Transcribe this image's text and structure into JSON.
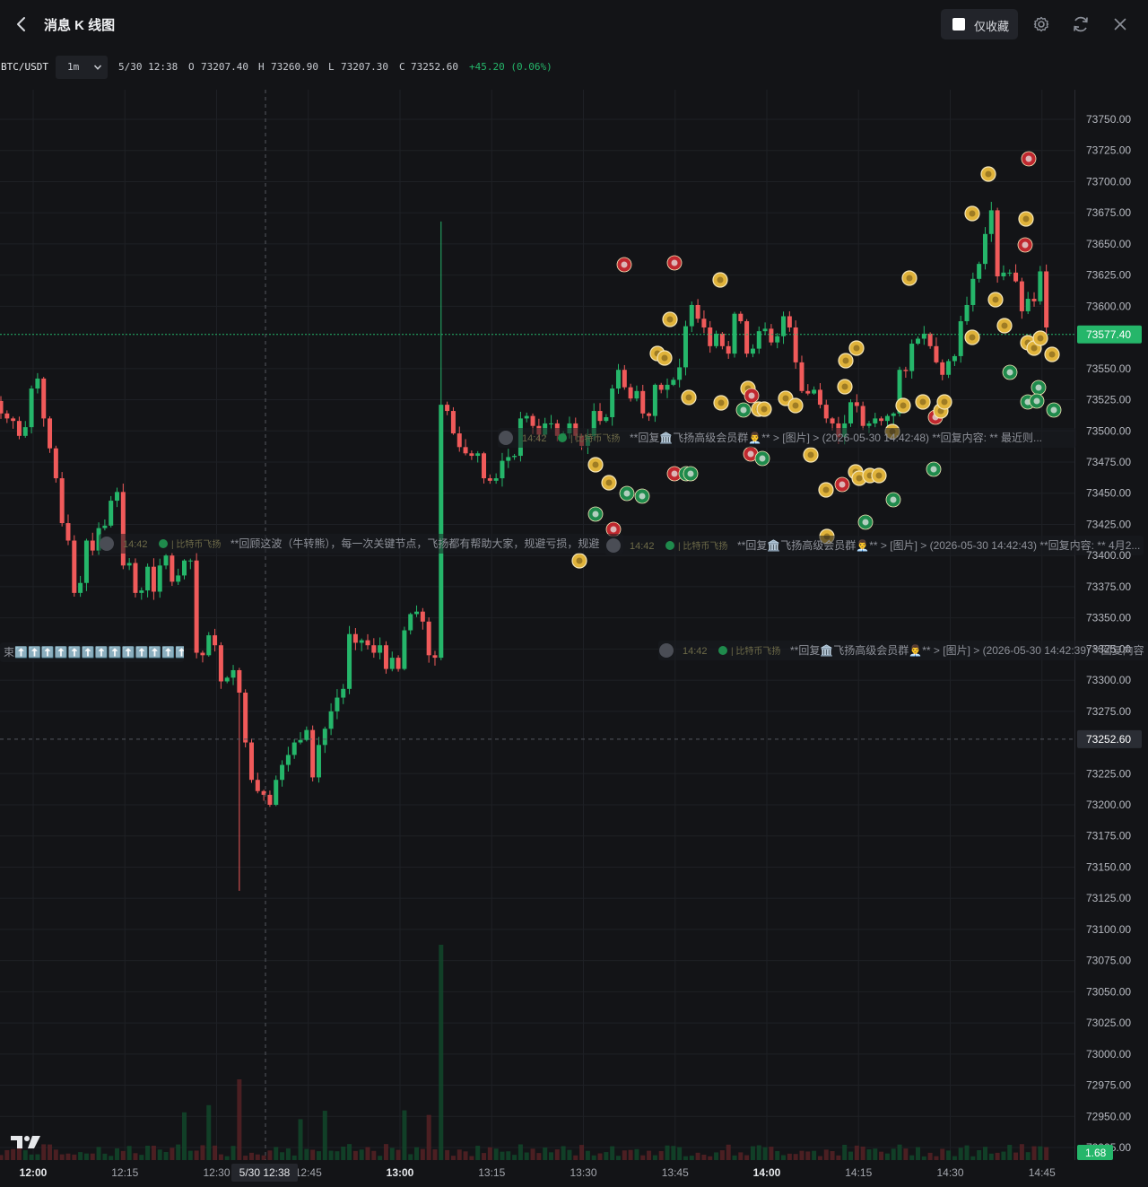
{
  "header": {
    "title": "消息 K 线图",
    "fav_label": "仅收藏"
  },
  "legend": {
    "symbol": "BTC/USDT",
    "interval": "1m",
    "time": "5/30 12:38",
    "o_label": "O",
    "o": "73207.40",
    "h_label": "H",
    "h": "73260.90",
    "l_label": "L",
    "l": "73207.30",
    "c_label": "C",
    "c": "73252.60",
    "change": "+45.20 (0.06%)"
  },
  "price_axis": [
    "73750.00",
    "73725.00",
    "73700.00",
    "73675.00",
    "73650.00",
    "73625.00",
    "73600.00",
    "73550.00",
    "73525.00",
    "73500.00",
    "73475.00",
    "73450.00",
    "73425.00",
    "73400.00",
    "73375.00",
    "73350.00",
    "73325.00",
    "73300.00",
    "73275.00",
    "73225.00",
    "73200.00",
    "73175.00",
    "73150.00",
    "73125.00",
    "73100.00",
    "73075.00",
    "73050.00",
    "73025.00",
    "73000.00",
    "72975.00",
    "72950.00",
    "72925.00"
  ],
  "price_labels": {
    "last": "73577.40",
    "crosshair": "73252.60",
    "volume": "1.68"
  },
  "time_axis": [
    "12:00",
    "12:15",
    "12:30",
    "12:45",
    "13:00",
    "13:15",
    "13:30",
    "13:45",
    "14:00",
    "14:15",
    "14:30",
    "14:45"
  ],
  "crosshair_date": "5/30 12:38",
  "message_rows": [
    {
      "time": "14:42",
      "channel": "比特币飞扬",
      "text": "**回复🏛️飞扬高级会员群👨‍💼** > [图片] > (2026-05-30 14:42:48) **回复内容: ** 最近则..."
    },
    {
      "time": "14:42",
      "channel": "比特币飞扬",
      "text": "**回顾这波（牛转熊），每一次关键节点，飞扬都有帮助大家，规避亏损，规避"
    },
    {
      "time": "14:42",
      "channel": "比特币飞扬",
      "text": "**回复🏛️飞扬高级会员群👨‍💼** > [图片] > (2026-05-30 14:42:43) **回复内容: ** 4月2..."
    },
    {
      "time": "",
      "channel": "",
      "text": "束⬆️⬆️⬆️⬆️⬆️⬆️⬆️⬆️⬆️⬆️⬆️⬆️⬆️"
    },
    {
      "time": "14:42",
      "channel": "比特币飞扬",
      "text": "**回复🏛️飞扬高级会员群👨‍💼** > [图片] > (2026-05-30 14:42:39) **回复内容"
    }
  ],
  "colors": {
    "up": "#25b66a",
    "down": "#f05a5a",
    "background": "#131417",
    "grid": "#1e2025",
    "marker_yellow": "#e0b33a",
    "marker_red": "#c0282f",
    "marker_green": "#1f8a4c"
  },
  "icons": {
    "back": "chevron-left-icon",
    "settings": "gear-icon",
    "refresh": "refresh-icon",
    "close": "close-icon",
    "dropdown": "chevron-down-icon",
    "logo": "tradingview-logo"
  },
  "chart_data": {
    "type": "candlestick",
    "symbol": "BTC/USDT",
    "interval": "1m",
    "y_range": [
      72917,
      73755
    ],
    "x_range": [
      "12:00",
      "14:55"
    ],
    "candles_close": [
      73514,
      73510,
      73508,
      73496,
      73503,
      73534,
      73542,
      73510,
      73486,
      73462,
      73426,
      73412,
      73370,
      73378,
      73412,
      73404,
      73422,
      73424,
      73444,
      73451,
      73392,
      73394,
      73370,
      73372,
      73391,
      73371,
      73392,
      73400,
      73379,
      73384,
      73396,
      73396,
      73322,
      73320,
      73336,
      73328,
      73299,
      73302,
      73308,
      73290,
      73250,
      73220,
      73211,
      73208,
      73200,
      73220,
      73232,
      73240,
      73250,
      73252,
      73260,
      73222,
      73248,
      73261,
      73275,
      73286,
      73293,
      73337,
      73330,
      73332,
      73328,
      73322,
      73328,
      73309,
      73318,
      73309,
      73340,
      73353,
      73355,
      73347,
      73320,
      73318,
      73521,
      73516,
      73498,
      73487,
      73482,
      73480,
      73482,
      73462,
      73460,
      73462,
      73476,
      73479,
      73480,
      73510,
      73512,
      73504,
      73497,
      73506,
      73506,
      73496,
      73498,
      73506,
      73496,
      73488,
      73496,
      73516,
      73508,
      73511,
      73534,
      73549,
      73535,
      73526,
      73532,
      73514,
      73512,
      73537,
      73533,
      73537,
      73541,
      73551,
      73584,
      73601,
      73590,
      73583,
      73568,
      73578,
      73568,
      73562,
      73594,
      73588,
      73562,
      73566,
      73580,
      73582,
      73571,
      73576,
      73592,
      73583,
      73555,
      73532,
      73530,
      73533,
      73521,
      73510,
      73506,
      73495,
      73506,
      73523,
      73520,
      73504,
      73506,
      73510,
      73508,
      73512,
      73514,
      73549,
      73548,
      73570,
      73574,
      73578,
      73568,
      73555,
      73545,
      73556,
      73560,
      73588,
      73601,
      73622,
      73634,
      73658,
      73677,
      73624,
      73627,
      73627,
      73620,
      73596,
      73606,
      73604,
      73628,
      73583
    ],
    "volume_label": "1.68"
  }
}
